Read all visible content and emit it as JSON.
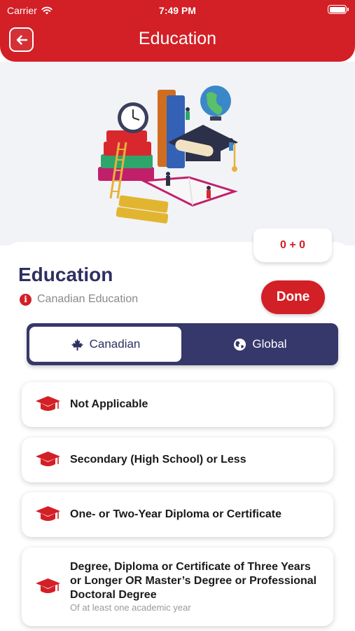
{
  "status_bar": {
    "carrier": "Carrier",
    "time": "7:49 PM"
  },
  "header": {
    "title": "Education",
    "back_icon": "arrow-left-icon"
  },
  "score": {
    "text": "0 + 0"
  },
  "section": {
    "title": "Education",
    "subtitle": "Canadian Education",
    "done_label": "Done"
  },
  "segments": [
    {
      "label": "Canadian",
      "icon": "maple-leaf-icon",
      "selected": true
    },
    {
      "label": "Global",
      "icon": "globe-icon",
      "selected": false
    }
  ],
  "options": [
    {
      "label": "Not Applicable",
      "note": ""
    },
    {
      "label": "Secondary (High School) or Less",
      "note": ""
    },
    {
      "label": "One- or Two-Year Diploma or Certificate",
      "note": ""
    },
    {
      "label": "Degree, Diploma or Certificate of Three Years or Longer OR Master’s Degree or Professional Doctoral Degree",
      "note": "Of at least one academic year"
    }
  ],
  "colors": {
    "brand_red": "#d31f26",
    "navy": "#36376b",
    "title_navy": "#2e2f63"
  }
}
